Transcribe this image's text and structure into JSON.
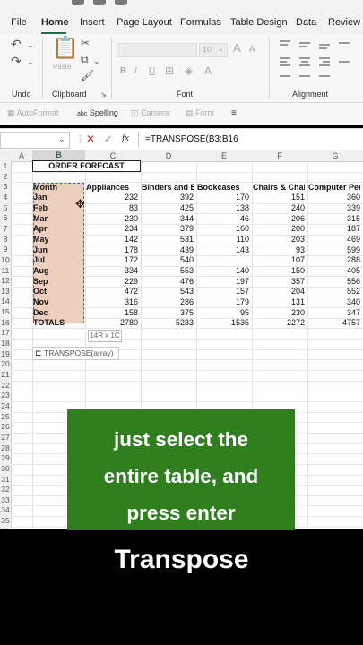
{
  "menu": {
    "tabs": [
      "File",
      "Home",
      "Insert",
      "Page Layout",
      "Formulas",
      "Table Design",
      "Data",
      "Review"
    ],
    "active": "Home"
  },
  "ribbon": {
    "groups": [
      "Undo",
      "Clipboard",
      "Font",
      "Alignment"
    ],
    "paste_label": "Paste",
    "font_size": "10",
    "bold": "B",
    "italic": "I",
    "underline": "U",
    "grow": "A",
    "shrink": "A"
  },
  "toolbar2": {
    "items": [
      "AutoFormat",
      "Spelling",
      "Camera",
      "Form"
    ]
  },
  "formula_bar": {
    "cancel": "✕",
    "confirm": "✓",
    "fx": "fx",
    "formula": "=TRANSPOSE(B3:B16"
  },
  "columns": [
    "A",
    "B",
    "C",
    "D",
    "E",
    "F",
    "G"
  ],
  "rows": [
    "1",
    "2",
    "3",
    "4",
    "5",
    "6",
    "7",
    "8",
    "9",
    "10",
    "11",
    "12",
    "13",
    "14",
    "15",
    "16",
    "17",
    "18",
    "19",
    "20",
    "21",
    "22",
    "23",
    "24",
    "25",
    "26",
    "27",
    "28",
    "29",
    "30",
    "31",
    "32",
    "33",
    "34",
    "35",
    "36"
  ],
  "sheet": {
    "title": "ORDER FORECAST",
    "headers": [
      "Month",
      "Appliances",
      "Binders and B",
      "Bookcases",
      "Chairs & Chai",
      "Computer Per"
    ],
    "data": [
      [
        "Jan",
        "232",
        "392",
        "170",
        "151",
        "360"
      ],
      [
        "Feb",
        "83",
        "425",
        "138",
        "240",
        "339"
      ],
      [
        "Mar",
        "230",
        "344",
        "46",
        "206",
        "315"
      ],
      [
        "Apr",
        "234",
        "379",
        "160",
        "200",
        "187"
      ],
      [
        "May",
        "142",
        "531",
        "110",
        "203",
        "469"
      ],
      [
        "Jun",
        "178",
        "439",
        "143",
        "93",
        "599"
      ],
      [
        "Jul",
        "172",
        "540",
        "",
        "107",
        "288"
      ],
      [
        "Aug",
        "334",
        "553",
        "140",
        "150",
        "405"
      ],
      [
        "Sep",
        "229",
        "476",
        "197",
        "357",
        "556"
      ],
      [
        "Oct",
        "472",
        "543",
        "157",
        "204",
        "552"
      ],
      [
        "Nov",
        "316",
        "286",
        "179",
        "131",
        "340"
      ],
      [
        "Dec",
        "158",
        "375",
        "95",
        "230",
        "347"
      ],
      [
        "TOTALS",
        "2780",
        "5283",
        "1535",
        "2272",
        "4757"
      ]
    ],
    "dim_tip": "14R x 1C",
    "autocomplete": "TRANSPOSE(array)"
  },
  "caption": {
    "lines": [
      "just select the",
      "entire table, and",
      "press enter"
    ]
  },
  "title": "Transpose"
}
